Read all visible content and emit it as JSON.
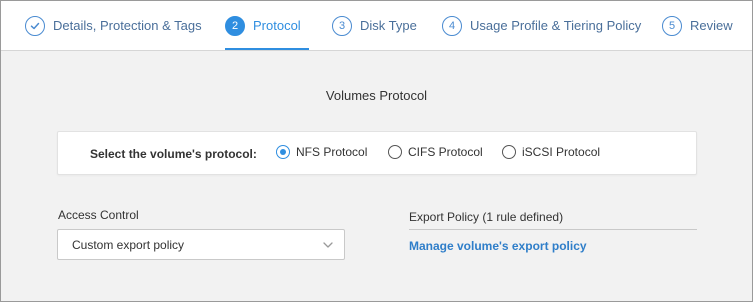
{
  "stepper": {
    "steps": [
      {
        "number": "✓",
        "label": "Details, Protection & Tags",
        "state": "completed"
      },
      {
        "number": "2",
        "label": "Protocol",
        "state": "active"
      },
      {
        "number": "3",
        "label": "Disk Type",
        "state": "pending"
      },
      {
        "number": "4",
        "label": "Usage Profile & Tiering Policy",
        "state": "pending"
      },
      {
        "number": "5",
        "label": "Review",
        "state": "pending"
      }
    ]
  },
  "protocol": {
    "title": "Volumes Protocol",
    "prompt": "Select the volume's protocol:",
    "options": [
      {
        "label": "NFS Protocol",
        "selected": true
      },
      {
        "label": "CIFS Protocol",
        "selected": false
      },
      {
        "label": "iSCSI Protocol",
        "selected": false
      }
    ]
  },
  "access_control": {
    "label": "Access Control",
    "selected_value": "Custom export policy",
    "icon": "chevron-down-icon"
  },
  "export_policy": {
    "title": "Export Policy (1 rule defined)",
    "link_label": "Manage volume's export policy"
  },
  "colors": {
    "accent": "#2f8ee0",
    "link": "#2f7ec9",
    "background": "#f2f2f2"
  }
}
